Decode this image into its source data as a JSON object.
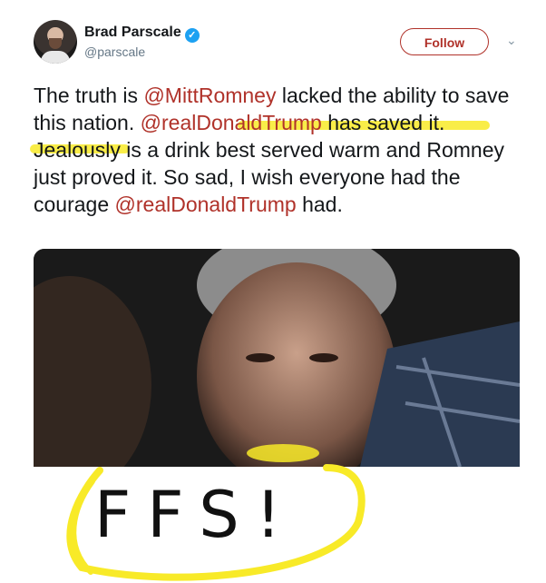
{
  "author": {
    "name": "Brad Parscale",
    "handle": "@parscale"
  },
  "actions": {
    "follow_label": "Follow"
  },
  "tweet": {
    "s1": "The truth is ",
    "m1": "@MittRomney",
    "s2": " lacked the ability to save this nation. ",
    "m2": "@realDonaldTrump",
    "s3": " has saved it. Jealously is a drink best served warm and Romney just proved it. So sad, I wish everyone had the courage ",
    "m3": "@realDonaldTrump",
    "s4": " had."
  },
  "annotation": {
    "text": "FFS!"
  },
  "colors": {
    "accent": "#b0322a",
    "highlight": "#f8ea28"
  }
}
